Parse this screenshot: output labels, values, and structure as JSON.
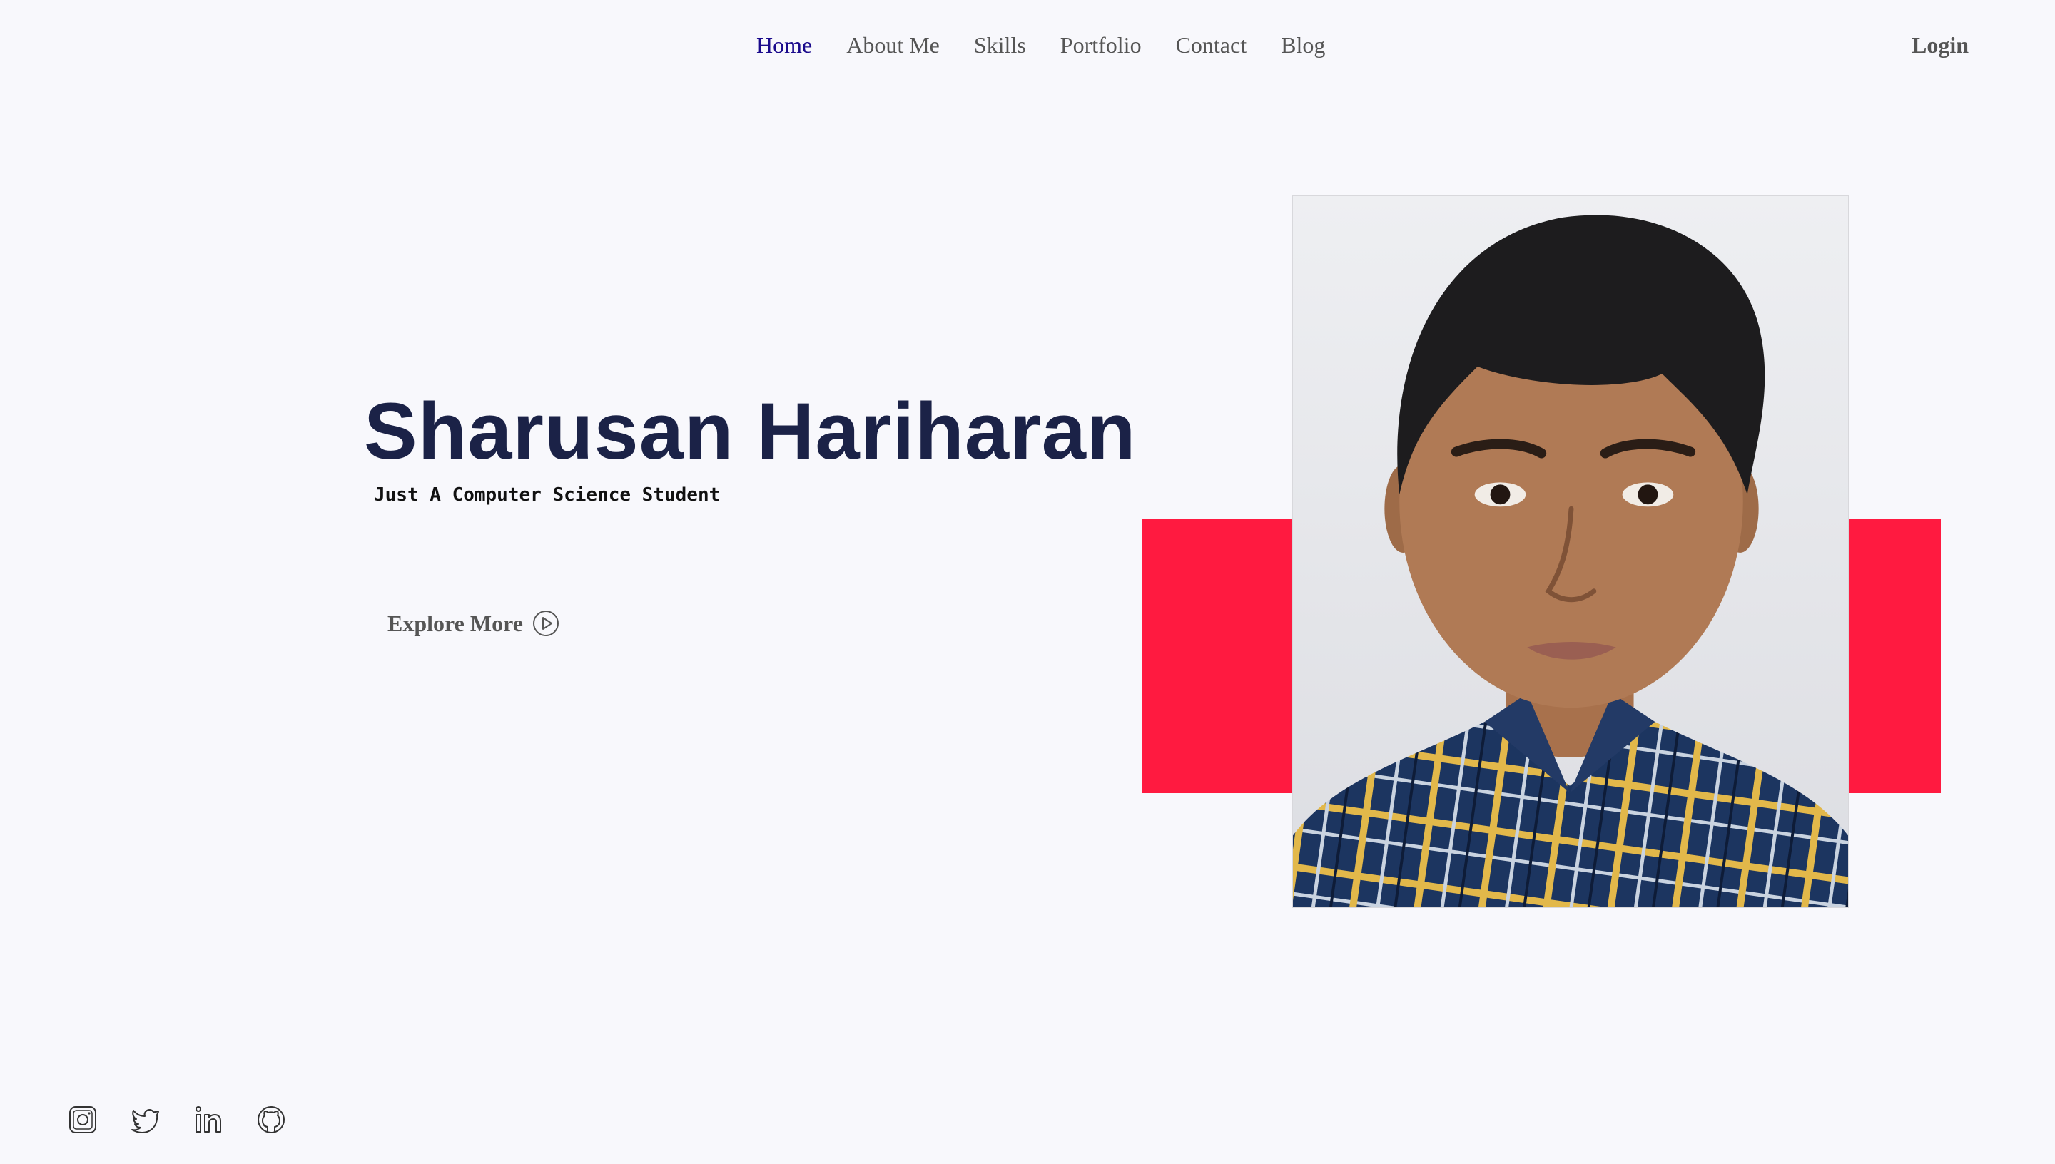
{
  "nav": {
    "items": [
      {
        "label": "Home",
        "active": true
      },
      {
        "label": "About Me"
      },
      {
        "label": "Skills"
      },
      {
        "label": "Portfolio"
      },
      {
        "label": "Contact"
      },
      {
        "label": "Blog"
      }
    ],
    "login_label": "Login"
  },
  "hero": {
    "name": "Sharusan Hariharan",
    "subtitle": "Just A Computer Science Student",
    "cta_label": "Explore More",
    "cta_icon": "play-circle-icon"
  },
  "socials": [
    "instagram-icon",
    "twitter-icon",
    "linkedin-icon",
    "github-icon"
  ],
  "colors": {
    "background": "#f8f8fc",
    "accent": "#ff1a40",
    "name": "#1b2247",
    "nav_active": "#1a0a8c",
    "nav_text": "#555555"
  }
}
